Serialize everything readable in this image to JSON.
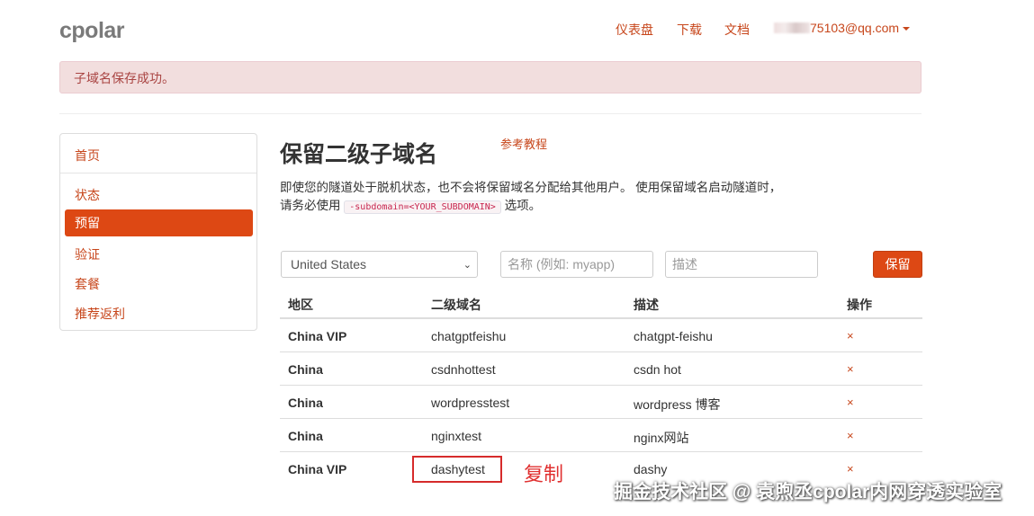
{
  "header": {
    "logo": "cpolar",
    "nav": [
      {
        "label": "仪表盘"
      },
      {
        "label": "下载"
      },
      {
        "label": "文档"
      }
    ],
    "user_email": "75103@qq.com"
  },
  "alert": {
    "message": "子域名保存成功。"
  },
  "sidebar": {
    "items": [
      {
        "label": "首页"
      },
      {
        "label": "状态"
      },
      {
        "label": "预留",
        "active": true
      },
      {
        "label": "验证"
      },
      {
        "label": "套餐"
      },
      {
        "label": "推荐返利"
      }
    ]
  },
  "main": {
    "title": "保留二级子域名",
    "ref_link": "参考教程",
    "desc_part1": "即使您的隧道处于脱机状态，也不会将保留域名分配给其他用户。 使用保留域名启动隧道时，请务必使用",
    "desc_code": "-subdomain=<YOUR_SUBDOMAIN>",
    "desc_part2": "选项。"
  },
  "form": {
    "region_selected": "United States",
    "name_placeholder": "名称 (例如: myapp)",
    "desc_placeholder": "描述",
    "save_label": "保留"
  },
  "table": {
    "headers": {
      "region": "地区",
      "subdomain": "二级域名",
      "description": "描述",
      "action": "操作"
    },
    "rows": [
      {
        "region": "China VIP",
        "subdomain": "chatgptfeishu",
        "description": "chatgpt-feishu",
        "action": "×"
      },
      {
        "region": "China",
        "subdomain": "csdnhottest",
        "description": "csdn hot",
        "action": "×"
      },
      {
        "region": "China",
        "subdomain": "wordpresstest",
        "description": "wordpress 博客",
        "action": "×"
      },
      {
        "region": "China",
        "subdomain": "nginxtest",
        "description": "nginx网站",
        "action": "×"
      },
      {
        "region": "China VIP",
        "subdomain": "dashytest",
        "description": "dashy",
        "action": "×"
      }
    ]
  },
  "annotation": {
    "copy_note": "复制"
  },
  "watermark": "掘金技术社区 @ 袁煦丞cpolar内网穿透实验室",
  "colors": {
    "accent": "#dd4814",
    "link": "#c7461b",
    "alert_bg": "#f2dede",
    "alert_text": "#a94442",
    "annotation_red": "#d62b2b"
  }
}
